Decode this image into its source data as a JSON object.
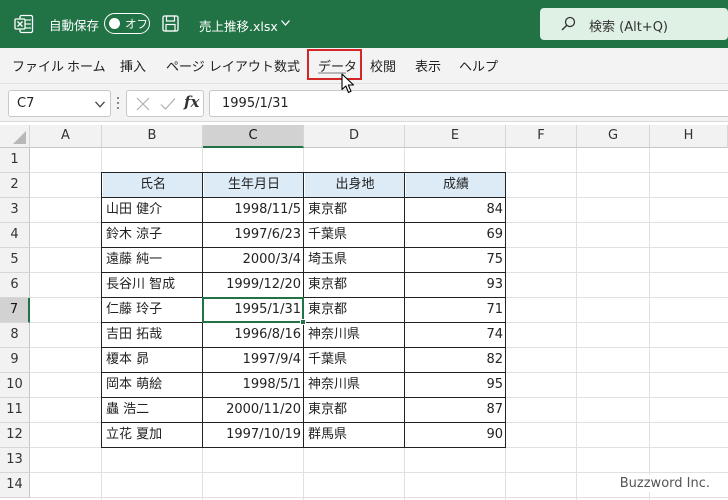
{
  "titlebar": {
    "autosave_label": "自動保存",
    "autosave_state": "オフ",
    "file_name": "売上推移.xlsx",
    "search_placeholder": "検索 (Alt+Q)",
    "bg_color": "#217346"
  },
  "menu": {
    "items": [
      "ファイル",
      "ホーム",
      "挿入",
      "ページ レイアウト",
      "数式",
      "データ",
      "校閲",
      "表示",
      "ヘルプ"
    ],
    "highlighted": "データ",
    "highlight_color": "#d32626"
  },
  "formula_bar": {
    "name_box": "C7",
    "fx_label": "fx",
    "value": "1995/1/31"
  },
  "sheet": {
    "columns": [
      "A",
      "B",
      "C",
      "D",
      "E",
      "F",
      "G",
      "H"
    ],
    "rows": [
      "1",
      "2",
      "3",
      "4",
      "5",
      "6",
      "7",
      "8",
      "9",
      "10",
      "11",
      "12",
      "13",
      "14"
    ],
    "selected_cell": "C7",
    "table": {
      "headers": [
        "氏名",
        "生年月日",
        "出身地",
        "成績"
      ],
      "rows": [
        [
          "山田 健介",
          "1998/11/5",
          "東京都",
          "84"
        ],
        [
          "鈴木 涼子",
          "1997/6/23",
          "千葉県",
          "69"
        ],
        [
          "遠藤 純一",
          "2000/3/4",
          "埼玉県",
          "75"
        ],
        [
          "長谷川 智成",
          "1999/12/20",
          "東京都",
          "93"
        ],
        [
          "仁藤 玲子",
          "1995/1/31",
          "東京都",
          "71"
        ],
        [
          "吉田 拓哉",
          "1996/8/16",
          "神奈川県",
          "74"
        ],
        [
          "榎本 昴",
          "1997/9/4",
          "千葉県",
          "82"
        ],
        [
          "岡本 萌絵",
          "1998/5/1",
          "神奈川県",
          "95"
        ],
        [
          "蟲 浩二",
          "2000/11/20",
          "東京都",
          "87"
        ],
        [
          "立花 夏加",
          "1997/10/19",
          "群馬県",
          "90"
        ]
      ]
    }
  },
  "watermark": "Buzzword Inc."
}
